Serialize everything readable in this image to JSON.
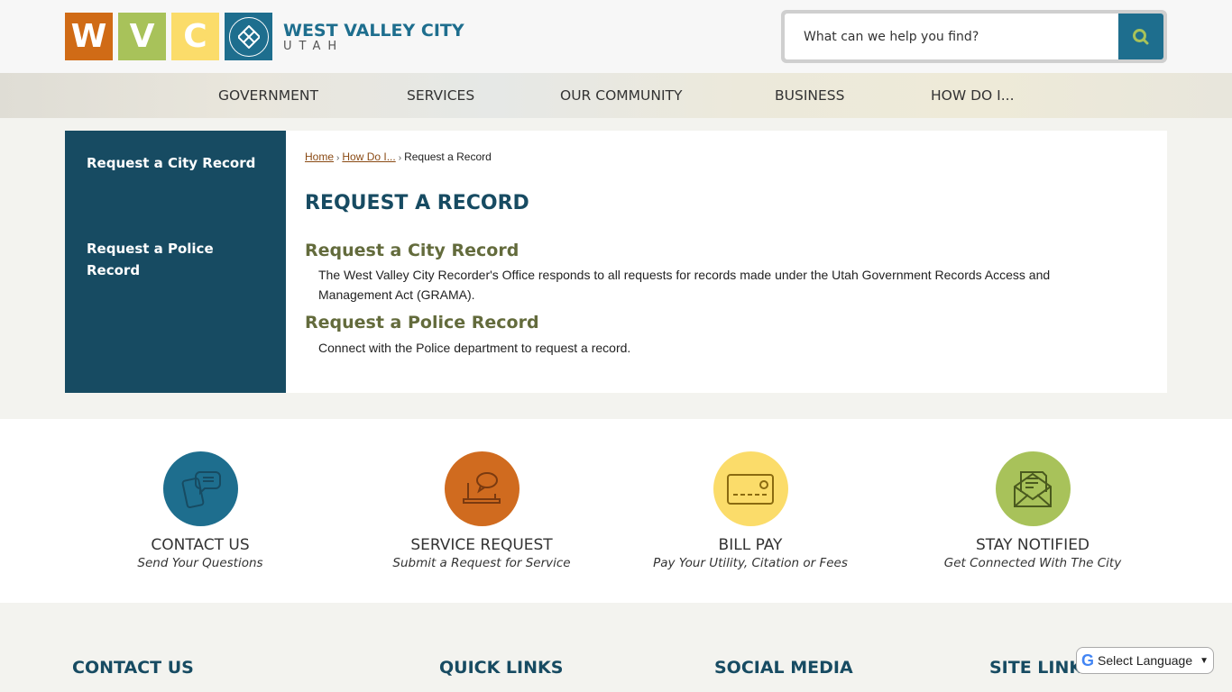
{
  "header": {
    "logo_letters": [
      "W",
      "V",
      "C"
    ],
    "city_name": "WEST VALLEY CITY",
    "state": "UTAH",
    "search_placeholder": "What can we help you find?",
    "search_icon": "search-icon"
  },
  "nav": {
    "items": [
      "GOVERNMENT",
      "SERVICES",
      "OUR COMMUNITY",
      "BUSINESS",
      "HOW DO I..."
    ]
  },
  "sidebar": {
    "items": [
      {
        "label": "Request a City Record"
      },
      {
        "label": "Request a Police Record"
      }
    ]
  },
  "breadcrumb": {
    "home": "Home",
    "parent": "How Do I...",
    "current": "Request a Record",
    "separator": "›"
  },
  "main": {
    "title": "REQUEST A RECORD",
    "sections": [
      {
        "title": "Request a City Record",
        "description": "The West Valley City Recorder's Office responds to all requests for records made under the Utah Government Records Access and Management Act (GRAMA)."
      },
      {
        "title": "Request a Police Record",
        "description": "Connect with the Police department to request a record."
      }
    ]
  },
  "quick_links": [
    {
      "label": "CONTACT US",
      "sub": "Send Your Questions",
      "icon": "phone-chat-icon",
      "color": "#1e6e8e"
    },
    {
      "label": "SERVICE REQUEST",
      "sub": "Submit a Request for Service",
      "icon": "laptop-chat-icon",
      "color": "#d06b1f"
    },
    {
      "label": "BILL PAY",
      "sub": "Pay Your Utility, Citation or Fees",
      "icon": "credit-card-icon",
      "color": "#fbdc6a"
    },
    {
      "label": "STAY NOTIFIED",
      "sub": "Get Connected With The City",
      "icon": "envelope-letter-icon",
      "color": "#a8c25a"
    }
  ],
  "footer": {
    "headings": [
      "CONTACT US",
      "QUICK LINKS",
      "SOCIAL MEDIA",
      "SITE LINKS"
    ]
  },
  "language": {
    "label": "Select Language"
  },
  "colors": {
    "brand_blue": "#1e6e8e",
    "dark_teal": "#174b62",
    "orange": "#d06b16",
    "green": "#a8c25a",
    "yellow": "#fbdc6a",
    "olive_heading": "#636b3c"
  }
}
